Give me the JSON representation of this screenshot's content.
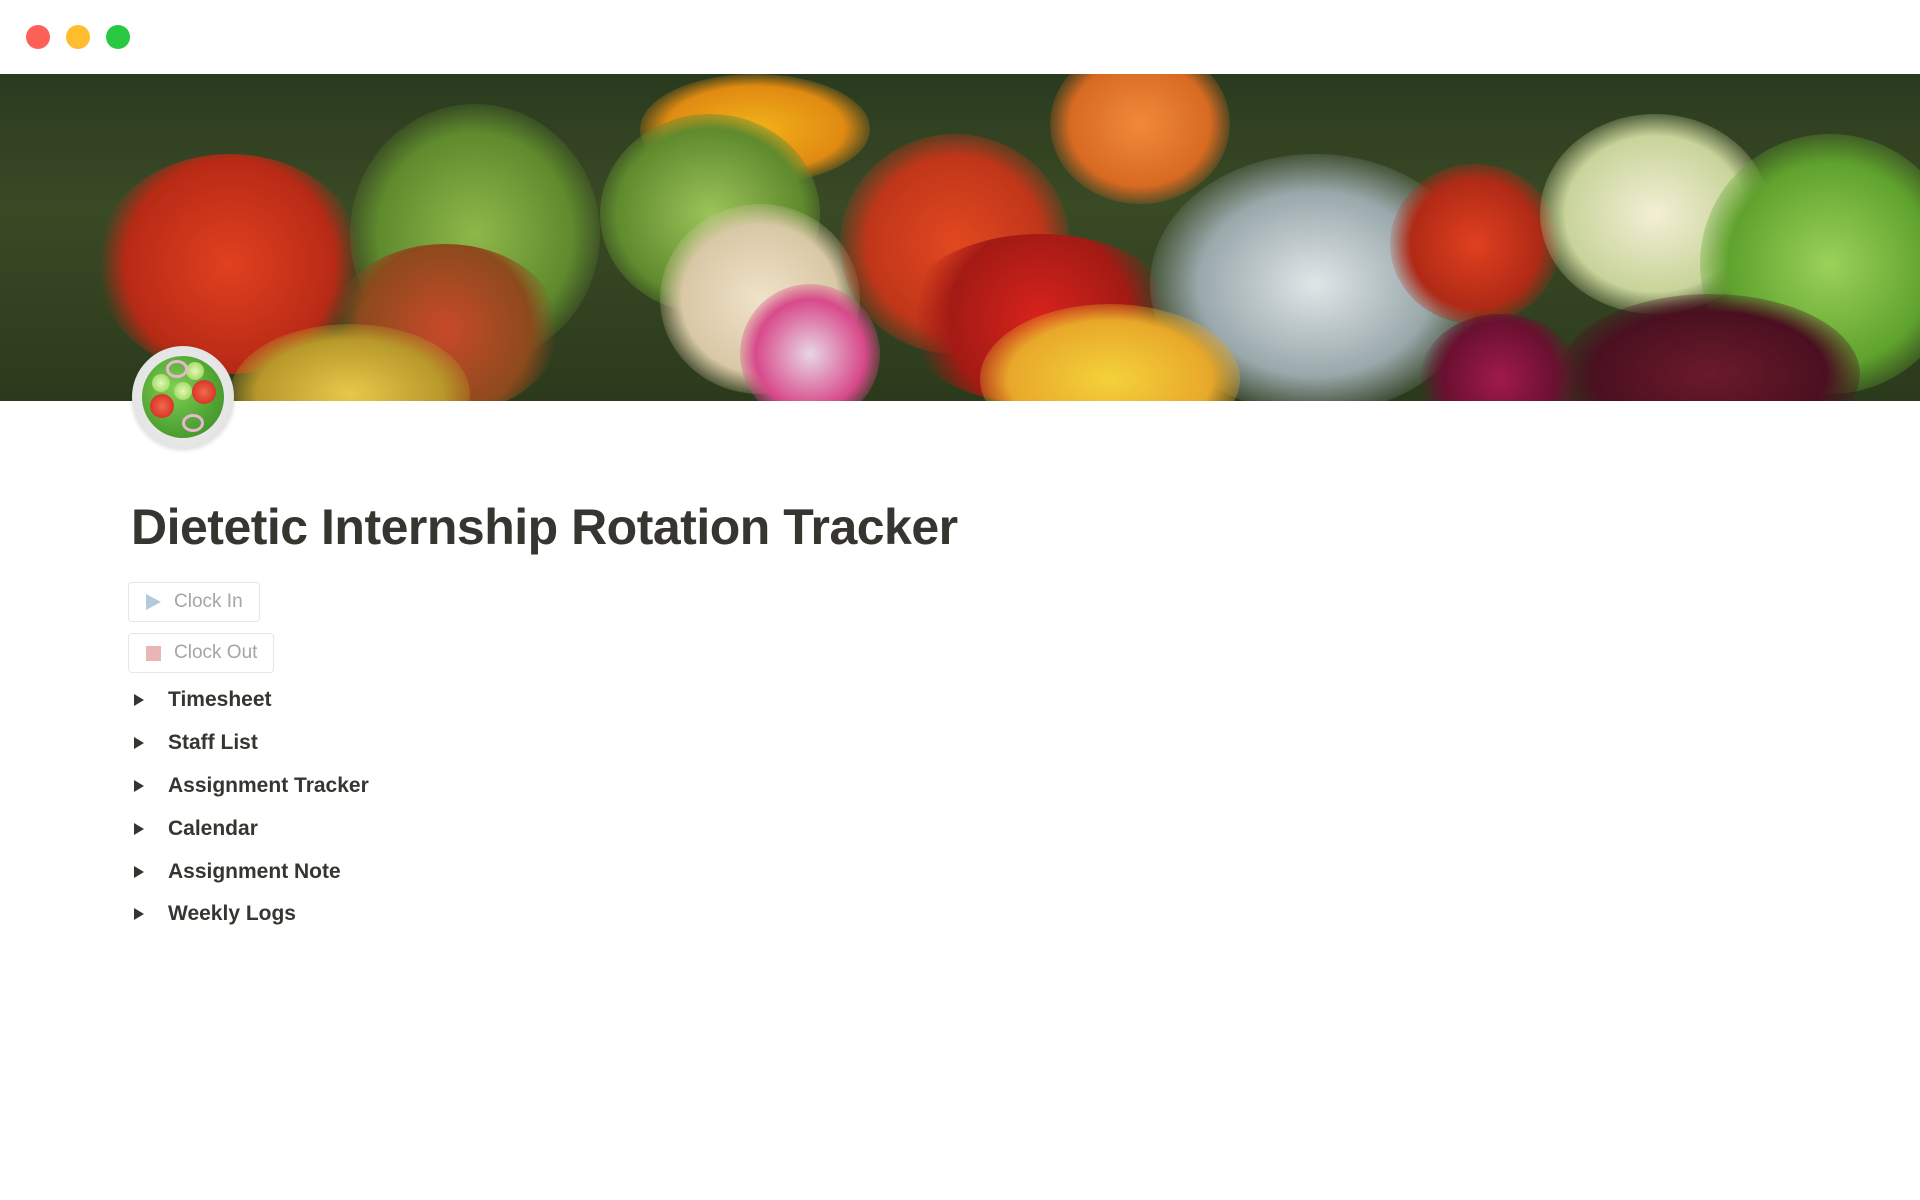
{
  "window": {
    "traffic_lights": {
      "close_color": "#fe5f57",
      "minimize_color": "#febc2e",
      "maximize_color": "#28c840"
    }
  },
  "page": {
    "cover_image": "fresh-vegetables-market-stall",
    "icon": "green-salad-emoji",
    "title": "Dietetic Internship Rotation Tracker"
  },
  "buttons": [
    {
      "label": "Clock In",
      "icon": "play-icon",
      "icon_color": "#b3cadc"
    },
    {
      "label": "Clock Out",
      "icon": "stop-icon",
      "icon_color": "#e8b6b5"
    }
  ],
  "toggles": [
    {
      "label": "Timesheet"
    },
    {
      "label": "Staff List"
    },
    {
      "label": "Assignment Tracker"
    },
    {
      "label": "Calendar"
    },
    {
      "label": "Assignment Note"
    },
    {
      "label": "Weekly Logs"
    }
  ]
}
